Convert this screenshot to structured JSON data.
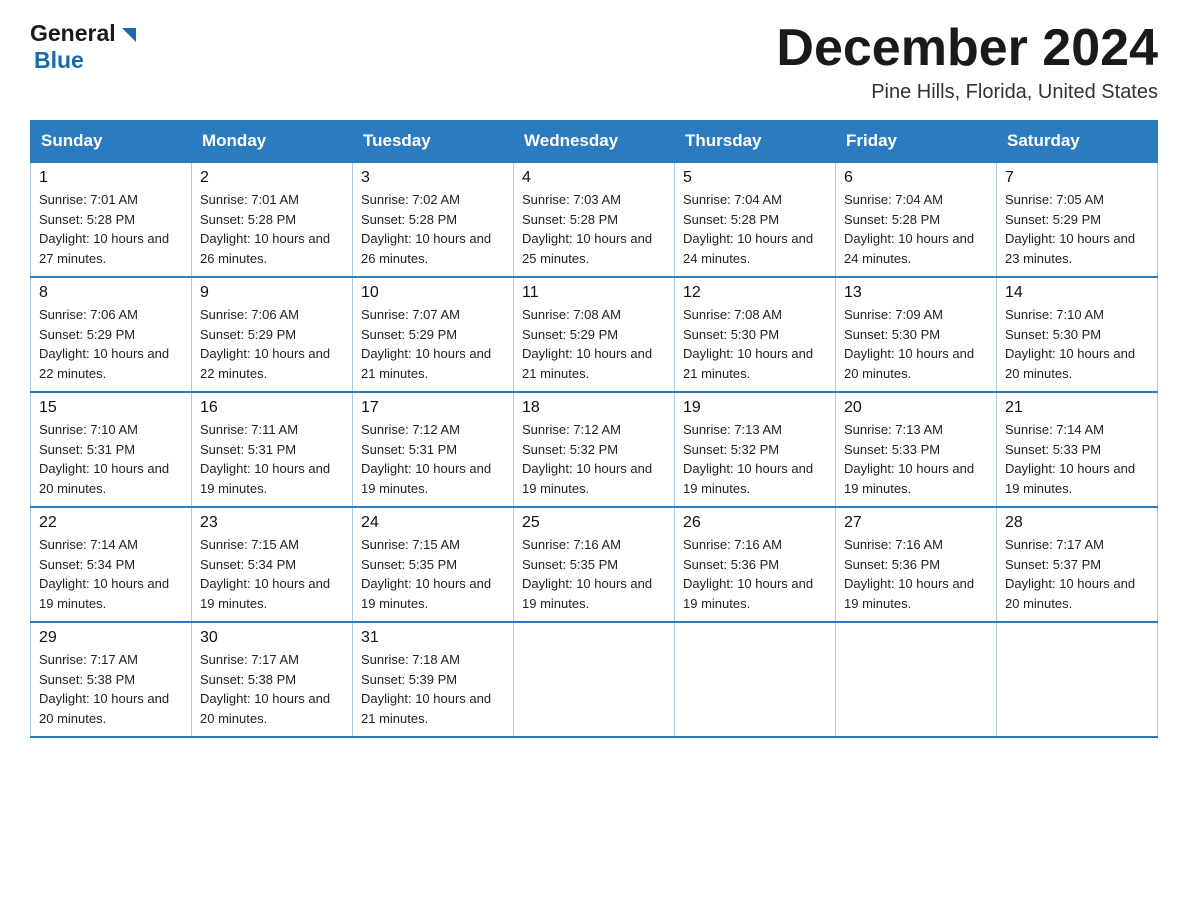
{
  "header": {
    "logo": {
      "general": "General",
      "blue": "Blue"
    },
    "title": "December 2024",
    "location": "Pine Hills, Florida, United States"
  },
  "calendar": {
    "weekdays": [
      "Sunday",
      "Monday",
      "Tuesday",
      "Wednesday",
      "Thursday",
      "Friday",
      "Saturday"
    ],
    "weeks": [
      [
        {
          "day": "1",
          "sunrise": "7:01 AM",
          "sunset": "5:28 PM",
          "daylight": "10 hours and 27 minutes."
        },
        {
          "day": "2",
          "sunrise": "7:01 AM",
          "sunset": "5:28 PM",
          "daylight": "10 hours and 26 minutes."
        },
        {
          "day": "3",
          "sunrise": "7:02 AM",
          "sunset": "5:28 PM",
          "daylight": "10 hours and 26 minutes."
        },
        {
          "day": "4",
          "sunrise": "7:03 AM",
          "sunset": "5:28 PM",
          "daylight": "10 hours and 25 minutes."
        },
        {
          "day": "5",
          "sunrise": "7:04 AM",
          "sunset": "5:28 PM",
          "daylight": "10 hours and 24 minutes."
        },
        {
          "day": "6",
          "sunrise": "7:04 AM",
          "sunset": "5:28 PM",
          "daylight": "10 hours and 24 minutes."
        },
        {
          "day": "7",
          "sunrise": "7:05 AM",
          "sunset": "5:29 PM",
          "daylight": "10 hours and 23 minutes."
        }
      ],
      [
        {
          "day": "8",
          "sunrise": "7:06 AM",
          "sunset": "5:29 PM",
          "daylight": "10 hours and 22 minutes."
        },
        {
          "day": "9",
          "sunrise": "7:06 AM",
          "sunset": "5:29 PM",
          "daylight": "10 hours and 22 minutes."
        },
        {
          "day": "10",
          "sunrise": "7:07 AM",
          "sunset": "5:29 PM",
          "daylight": "10 hours and 21 minutes."
        },
        {
          "day": "11",
          "sunrise": "7:08 AM",
          "sunset": "5:29 PM",
          "daylight": "10 hours and 21 minutes."
        },
        {
          "day": "12",
          "sunrise": "7:08 AM",
          "sunset": "5:30 PM",
          "daylight": "10 hours and 21 minutes."
        },
        {
          "day": "13",
          "sunrise": "7:09 AM",
          "sunset": "5:30 PM",
          "daylight": "10 hours and 20 minutes."
        },
        {
          "day": "14",
          "sunrise": "7:10 AM",
          "sunset": "5:30 PM",
          "daylight": "10 hours and 20 minutes."
        }
      ],
      [
        {
          "day": "15",
          "sunrise": "7:10 AM",
          "sunset": "5:31 PM",
          "daylight": "10 hours and 20 minutes."
        },
        {
          "day": "16",
          "sunrise": "7:11 AM",
          "sunset": "5:31 PM",
          "daylight": "10 hours and 19 minutes."
        },
        {
          "day": "17",
          "sunrise": "7:12 AM",
          "sunset": "5:31 PM",
          "daylight": "10 hours and 19 minutes."
        },
        {
          "day": "18",
          "sunrise": "7:12 AM",
          "sunset": "5:32 PM",
          "daylight": "10 hours and 19 minutes."
        },
        {
          "day": "19",
          "sunrise": "7:13 AM",
          "sunset": "5:32 PM",
          "daylight": "10 hours and 19 minutes."
        },
        {
          "day": "20",
          "sunrise": "7:13 AM",
          "sunset": "5:33 PM",
          "daylight": "10 hours and 19 minutes."
        },
        {
          "day": "21",
          "sunrise": "7:14 AM",
          "sunset": "5:33 PM",
          "daylight": "10 hours and 19 minutes."
        }
      ],
      [
        {
          "day": "22",
          "sunrise": "7:14 AM",
          "sunset": "5:34 PM",
          "daylight": "10 hours and 19 minutes."
        },
        {
          "day": "23",
          "sunrise": "7:15 AM",
          "sunset": "5:34 PM",
          "daylight": "10 hours and 19 minutes."
        },
        {
          "day": "24",
          "sunrise": "7:15 AM",
          "sunset": "5:35 PM",
          "daylight": "10 hours and 19 minutes."
        },
        {
          "day": "25",
          "sunrise": "7:16 AM",
          "sunset": "5:35 PM",
          "daylight": "10 hours and 19 minutes."
        },
        {
          "day": "26",
          "sunrise": "7:16 AM",
          "sunset": "5:36 PM",
          "daylight": "10 hours and 19 minutes."
        },
        {
          "day": "27",
          "sunrise": "7:16 AM",
          "sunset": "5:36 PM",
          "daylight": "10 hours and 19 minutes."
        },
        {
          "day": "28",
          "sunrise": "7:17 AM",
          "sunset": "5:37 PM",
          "daylight": "10 hours and 20 minutes."
        }
      ],
      [
        {
          "day": "29",
          "sunrise": "7:17 AM",
          "sunset": "5:38 PM",
          "daylight": "10 hours and 20 minutes."
        },
        {
          "day": "30",
          "sunrise": "7:17 AM",
          "sunset": "5:38 PM",
          "daylight": "10 hours and 20 minutes."
        },
        {
          "day": "31",
          "sunrise": "7:18 AM",
          "sunset": "5:39 PM",
          "daylight": "10 hours and 21 minutes."
        },
        null,
        null,
        null,
        null
      ]
    ]
  }
}
